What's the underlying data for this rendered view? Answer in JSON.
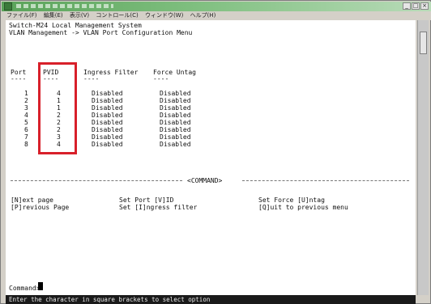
{
  "window": {
    "controls": [
      "_",
      "□",
      "×"
    ]
  },
  "menubar": {
    "items": [
      "ファイル(F)",
      "編集(E)",
      "表示(V)",
      "コントロール(C)",
      "ウィンドウ(W)",
      "ヘルプ(H)"
    ]
  },
  "terminal": {
    "header_line1": "Switch-M24 Local Management System",
    "header_line2": "VLAN Management -> VLAN Port Configuration Menu",
    "columns": {
      "port": "Port",
      "pvid": "PVID",
      "ingress": "Ingress Filter",
      "force": "Force Untag"
    },
    "column_underline": "----",
    "rows": [
      {
        "port": "1",
        "pvid": "4",
        "ingress": "Disabled",
        "force": "Disabled"
      },
      {
        "port": "2",
        "pvid": "1",
        "ingress": "Disabled",
        "force": "Disabled"
      },
      {
        "port": "3",
        "pvid": "1",
        "ingress": "Disabled",
        "force": "Disabled"
      },
      {
        "port": "4",
        "pvid": "2",
        "ingress": "Disabled",
        "force": "Disabled"
      },
      {
        "port": "5",
        "pvid": "2",
        "ingress": "Disabled",
        "force": "Disabled"
      },
      {
        "port": "6",
        "pvid": "2",
        "ingress": "Disabled",
        "force": "Disabled"
      },
      {
        "port": "7",
        "pvid": "3",
        "ingress": "Disabled",
        "force": "Disabled"
      },
      {
        "port": "8",
        "pvid": "4",
        "ingress": "Disabled",
        "force": "Disabled"
      }
    ],
    "command_divider": "<COMMAND>",
    "commands": {
      "next_page": "[N]ext page",
      "previous_page": "[P]revious Page",
      "set_port_vid": "Set Port [V]ID",
      "set_ingress": "Set [I]ngress filter",
      "set_force": "Set Force [U]ntag",
      "quit": "[Q]uit to previous menu"
    },
    "prompt": "Command>",
    "status": "Enter the character in square brackets to select option"
  },
  "colors": {
    "highlight_box": "#d8202a",
    "status_bar_bg": "#1a1a1a",
    "titlebar": "#5aa35a"
  }
}
